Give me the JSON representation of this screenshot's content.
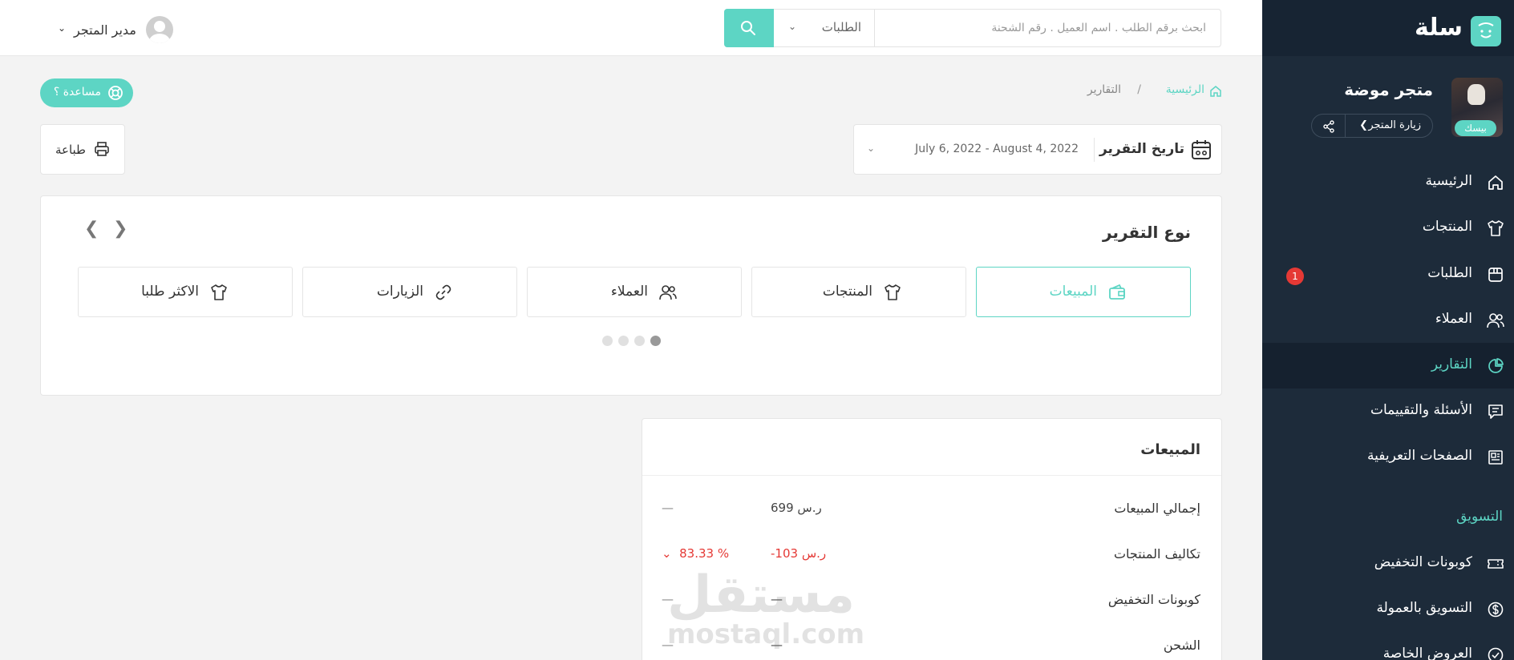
{
  "sidebar": {
    "logo": "سلة",
    "store_name": "متجر موضة",
    "plan_badge": "بيسك",
    "visit_store": "زيارة المتجر",
    "items": [
      {
        "label": "الرئيسية",
        "icon": "home-icon"
      },
      {
        "label": "المنتجات",
        "icon": "shirt-icon"
      },
      {
        "label": "الطلبات",
        "icon": "box-icon",
        "badge": "1"
      },
      {
        "label": "العملاء",
        "icon": "users-icon"
      },
      {
        "label": "التقارير",
        "icon": "pie-chart-icon",
        "active": true
      },
      {
        "label": "الأسئلة والتقييمات",
        "icon": "message-icon"
      },
      {
        "label": "الصفحات التعريفية",
        "icon": "newspaper-icon"
      }
    ],
    "marketing_section": "التسويق",
    "marketing_items": [
      {
        "label": "كوبونات التخفيض",
        "icon": "ticket-icon"
      },
      {
        "label": "التسويق بالعمولة",
        "icon": "dollar-circle-icon"
      },
      {
        "label": "العروض الخاصة",
        "icon": "offer-badge-icon"
      }
    ]
  },
  "header": {
    "user_name": "مدير المتجر",
    "search_placeholder": "ابحث برقم الطلب . اسم العميل . رقم الشحنة",
    "search_scope": "الطلبات"
  },
  "breadcrumb": {
    "home": "الرئيسية",
    "separator": "/",
    "current": "التقارير"
  },
  "help_button": "مساعدة ؟",
  "print_button": "طباعة",
  "date_filter": {
    "title": "تاريخ التقرير",
    "range": "July 6, 2022 - August 4, 2022"
  },
  "report_type": {
    "title": "نوع التقرير",
    "options": [
      {
        "label": "المبيعات",
        "icon": "wallet-icon",
        "active": true
      },
      {
        "label": "المنتجات",
        "icon": "shirt-icon"
      },
      {
        "label": "العملاء",
        "icon": "users-icon"
      },
      {
        "label": "الزيارات",
        "icon": "link-icon"
      },
      {
        "label": "الاكثر طلبا",
        "icon": "shirt-icon"
      }
    ],
    "page_dots": 4,
    "active_dot": 1
  },
  "sales": {
    "title": "المبيعات",
    "rows": [
      {
        "label": "إجمالي المبيعات",
        "value": "699 ر.س",
        "change": "—"
      },
      {
        "label": "تكاليف المنتجات",
        "value": "-103 ر.س",
        "change": "83.33 %",
        "negative": true
      },
      {
        "label": "كوبونات التخفيض",
        "value": "—",
        "change": "—"
      },
      {
        "label": "الشحن",
        "value": "—",
        "change": "—"
      }
    ]
  },
  "watermark": {
    "arabic": "مستقل",
    "latin": "mostaql.com"
  },
  "colors": {
    "accent": "#5dd5c4",
    "sidebar_bg": "#1d2b3a",
    "danger": "#e53935"
  }
}
